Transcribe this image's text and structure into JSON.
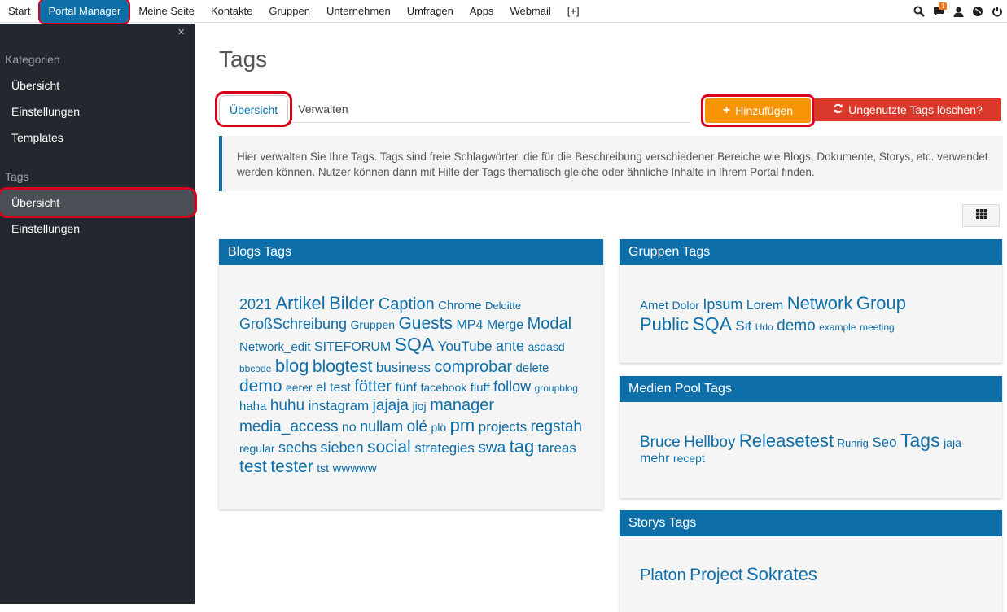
{
  "topnav": {
    "items": [
      "Start",
      "Portal Manager",
      "Meine Seite",
      "Kontakte",
      "Gruppen",
      "Unternehmen",
      "Umfragen",
      "Apps",
      "Webmail",
      "[+]"
    ],
    "notification_count": "1"
  },
  "sidebar": {
    "close": "×",
    "section1": "Kategorien",
    "section1_items": [
      "Übersicht",
      "Einstellungen",
      "Templates"
    ],
    "section2": "Tags",
    "section2_items": [
      "Übersicht",
      "Einstellungen"
    ]
  },
  "main": {
    "title": "Tags",
    "tabs": [
      "Übersicht",
      "Verwalten"
    ],
    "add_label": "Hinzufügen",
    "delete_label": "Ungenutzte Tags löschen?",
    "info": "Hier verwalten Sie Ihre Tags. Tags sind freie Schlagwörter, die für die Beschreibung verschiedener Bereiche wie Blogs, Dokumente, Storys, etc. verwendet werden können. Nutzer können dann mit Hilfe der Tags thematisch gleiche oder ähnliche Inhalte in Ihrem Portal finden."
  },
  "panels": {
    "blogs": {
      "title": "Blogs Tags",
      "tags": [
        [
          "2021",
          18
        ],
        [
          "Artikel",
          22
        ],
        [
          "Bilder",
          22
        ],
        [
          "Caption",
          20
        ],
        [
          "Chrome",
          15
        ],
        [
          "Deloitte",
          13
        ],
        [
          "GroßSchreibung",
          18
        ],
        [
          "Gruppen",
          14
        ],
        [
          "Guests",
          21
        ],
        [
          "MP4",
          16
        ],
        [
          "Merge",
          16
        ],
        [
          "Modal",
          20
        ],
        [
          "Network_edit",
          15
        ],
        [
          "SITEFORUM",
          16
        ],
        [
          "SQA",
          23
        ],
        [
          "YouTube",
          17
        ],
        [
          "ante",
          18
        ],
        [
          "asdasd",
          14
        ],
        [
          "bbcode",
          12
        ],
        [
          "blog",
          22
        ],
        [
          "blogtest",
          21
        ],
        [
          "business",
          17
        ],
        [
          "comprobar",
          20
        ],
        [
          "delete",
          15
        ],
        [
          "demo",
          21
        ],
        [
          "eerer",
          14
        ],
        [
          "el",
          16
        ],
        [
          "test",
          16
        ],
        [
          "fötter",
          20
        ],
        [
          "fünf",
          16
        ],
        [
          "facebook",
          14
        ],
        [
          "fluff",
          15
        ],
        [
          "follow",
          18
        ],
        [
          "groupblog",
          12
        ],
        [
          "haha",
          15
        ],
        [
          "huhu",
          19
        ],
        [
          "instagram",
          17
        ],
        [
          "jajaja",
          19
        ],
        [
          "jioj",
          14
        ],
        [
          "manager",
          20
        ],
        [
          "media_access",
          19
        ],
        [
          "no",
          16
        ],
        [
          "nullam",
          18
        ],
        [
          "olé",
          19
        ],
        [
          "plö",
          14
        ],
        [
          "pm",
          22
        ],
        [
          "projects",
          17
        ],
        [
          "regstah",
          19
        ],
        [
          "regular",
          14
        ],
        [
          "sechs",
          18
        ],
        [
          "sieben",
          18
        ],
        [
          "social",
          21
        ],
        [
          "strategies",
          17
        ],
        [
          "swa",
          19
        ],
        [
          "tag",
          22
        ],
        [
          "tareas",
          17
        ],
        [
          "test",
          21
        ],
        [
          "tester",
          21
        ],
        [
          "tst",
          14
        ],
        [
          "wwwww",
          15
        ]
      ]
    },
    "gruppen": {
      "title": "Gruppen Tags",
      "tags": [
        [
          "Amet",
          15
        ],
        [
          "Dolor",
          14
        ],
        [
          "Ipsum",
          18
        ],
        [
          "Lorem",
          16
        ],
        [
          "Network",
          22
        ],
        [
          "Group",
          22
        ],
        [
          "Public",
          22
        ],
        [
          "SQA",
          23
        ],
        [
          "Sit",
          17
        ],
        [
          "Udo",
          12
        ],
        [
          "demo",
          19
        ],
        [
          "example",
          12
        ],
        [
          "meeting",
          12
        ]
      ]
    },
    "medien": {
      "title": "Medien Pool Tags",
      "tags": [
        [
          "Bruce",
          19
        ],
        [
          "Hellboy",
          19
        ],
        [
          "Releasetest",
          22
        ],
        [
          "Runrig",
          13
        ],
        [
          "Seo",
          17
        ],
        [
          "Tags",
          23
        ],
        [
          "jaja",
          14
        ],
        [
          "mehr",
          16
        ],
        [
          "recept",
          14
        ]
      ]
    },
    "storys": {
      "title": "Storys Tags",
      "tags": [
        [
          "Platon",
          20
        ],
        [
          "Project",
          21
        ],
        [
          "Sokrates",
          22
        ]
      ]
    }
  }
}
